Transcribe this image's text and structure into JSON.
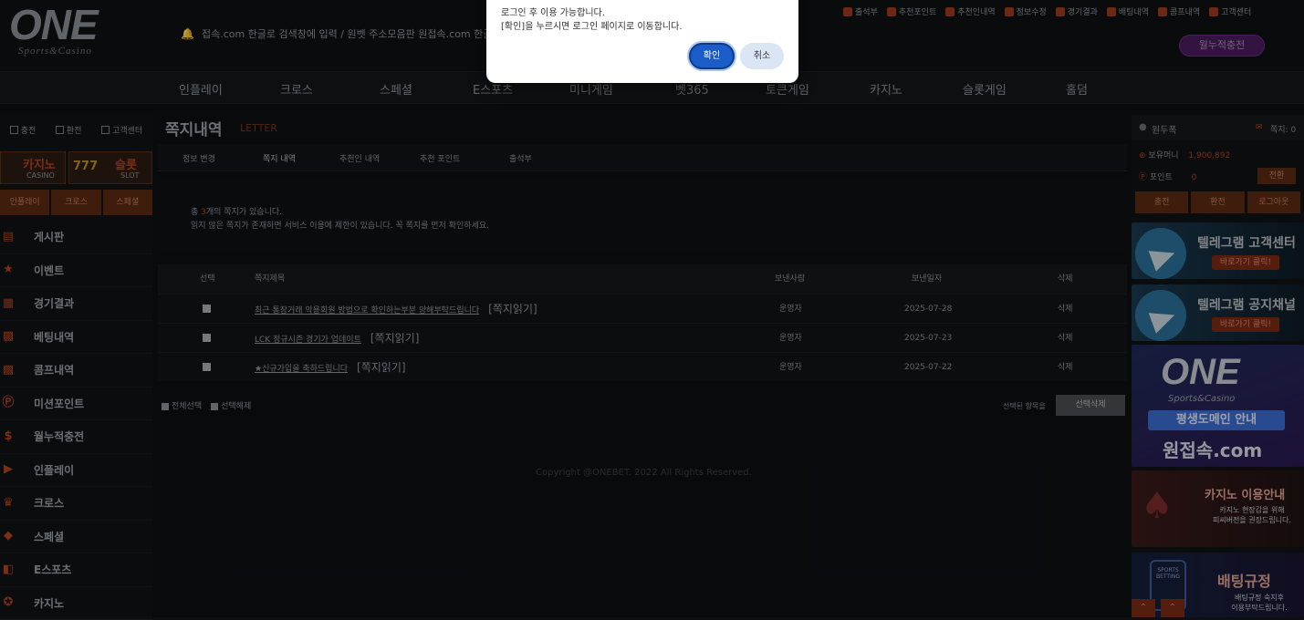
{
  "header": {
    "logo_main": "ONE",
    "logo_sub": "Sports&Casino",
    "ticker": "접속.com 한글로 검색창에 입력 / 원벳 주소모음판  원접속.com 한글로",
    "top_menu": [
      "출석부",
      "추천포인트",
      "추천인내역",
      "정보수정",
      "경기결과",
      "배팅내역",
      "콤프내역",
      "고객센터"
    ],
    "charge_button": "월누적충전"
  },
  "main_nav": [
    "인플레이",
    "크로스",
    "스페셜",
    "E스포츠",
    "미니게임",
    "벳365",
    "토큰게임",
    "카지노",
    "슬롯게임",
    "홀덤"
  ],
  "left_sidebar": {
    "tools": [
      "충전",
      "환전",
      "고객센터"
    ],
    "banners": [
      {
        "kr": "카지노",
        "en": "CASINO"
      },
      {
        "kr": "슬롯",
        "en": "SLOT"
      }
    ],
    "tabs": [
      "인플레이",
      "크로스",
      "스페셜"
    ],
    "menu": [
      {
        "label": "게시판",
        "icon": "board-icon"
      },
      {
        "label": "이벤트",
        "icon": "event-star-icon"
      },
      {
        "label": "경기결과",
        "icon": "scoreboard-icon"
      },
      {
        "label": "베팅내역",
        "icon": "betting-history-icon"
      },
      {
        "label": "콤프내역",
        "icon": "comp-history-icon"
      },
      {
        "label": "미션포인트",
        "icon": "point-p-icon"
      },
      {
        "label": "월누적충전",
        "icon": "dollar-icon"
      },
      {
        "label": "인플레이",
        "icon": "play-icon"
      },
      {
        "label": "크로스",
        "icon": "trophy-icon"
      },
      {
        "label": "스페셜",
        "icon": "special-box-icon"
      },
      {
        "label": "E스포츠",
        "icon": "esports-icon"
      },
      {
        "label": "카지노",
        "icon": "chip-icon"
      }
    ]
  },
  "content": {
    "title": "쪽지내역",
    "title_en": "LETTER",
    "sub_tabs": [
      "정보 변경",
      "쪽지 내역",
      "추천인 내역",
      "추천 포인트",
      "출석부"
    ],
    "active_tab": "쪽지 내역",
    "notice_prefix": "총 ",
    "notice_count": "3",
    "notice_suffix": "개의 쪽지가 있습니다.",
    "notice_line2": "읽지 않은 쪽지가 존재하면 서비스 이용에 제한이 있습니다. 꼭 쪽지를 먼저 확인하세요.",
    "table": {
      "headers": [
        "선택",
        "쪽지제목",
        "보낸사람",
        "보낸일자",
        "삭제"
      ],
      "rows": [
        {
          "subject": "최근 통장거래 악용회원 방법으로 확인하는부분 양해부탁드립니다",
          "read": "[쪽지읽기]",
          "sender": "운영자",
          "date": "2025-07-28",
          "delete": "삭제"
        },
        {
          "subject": "LCK 정규시즌 경기가 업데이트",
          "read": "[쪽지읽기]",
          "sender": "운영자",
          "date": "2025-07-23",
          "delete": "삭제"
        },
        {
          "subject": "★신규가입을 축하드립니다",
          "read": "[쪽지읽기]",
          "sender": "운영자",
          "date": "2025-07-22",
          "delete": "삭제"
        }
      ]
    },
    "select_all": "전체선택",
    "deselect": "선택해제",
    "selected_label": "선택된 항목을",
    "delete_selected": "선택삭제",
    "footer": "Copyright @ONEBET. 2022 All Rights Reserved."
  },
  "right_sidebar": {
    "username": "원두폭",
    "letters_label": "쪽지:",
    "letters_count": "0",
    "money_label": "보유머니",
    "money_value": "1,900,892",
    "point_label": "포인트",
    "point_value": "0",
    "convert_button": "전환",
    "buttons": [
      "충전",
      "환전",
      "로그아웃"
    ],
    "promos": [
      {
        "title": "텔레그램 고객센터",
        "pill": "바로가기 클릭!"
      },
      {
        "title": "텔레그램 공지채널",
        "pill": "바로가기 클릭!"
      },
      {
        "logo": "ONE",
        "logo_sub": "Sports&Casino",
        "line1": "평생도메인 안내",
        "line2": "원접속.com"
      },
      {
        "title": "카지노 이용안내",
        "sub": "카지노 현장감을 위해\n피씨버전을 권장드립니다."
      },
      {
        "title": "배팅규정",
        "sub": "배팅규정 숙지후\n이용부탁드립니다.",
        "badge": "SPORTS BETTING"
      }
    ]
  },
  "dialog": {
    "message1": "로그인 후 이용 가능합니다.",
    "message2": "[확인]을 누르시면 로그인 페이지로 이동합니다.",
    "ok": "확인",
    "cancel": "취소"
  },
  "colors": {
    "accent": "#b0421c",
    "background": "#0d0f12",
    "dialog_primary": "#1a5cc8"
  }
}
